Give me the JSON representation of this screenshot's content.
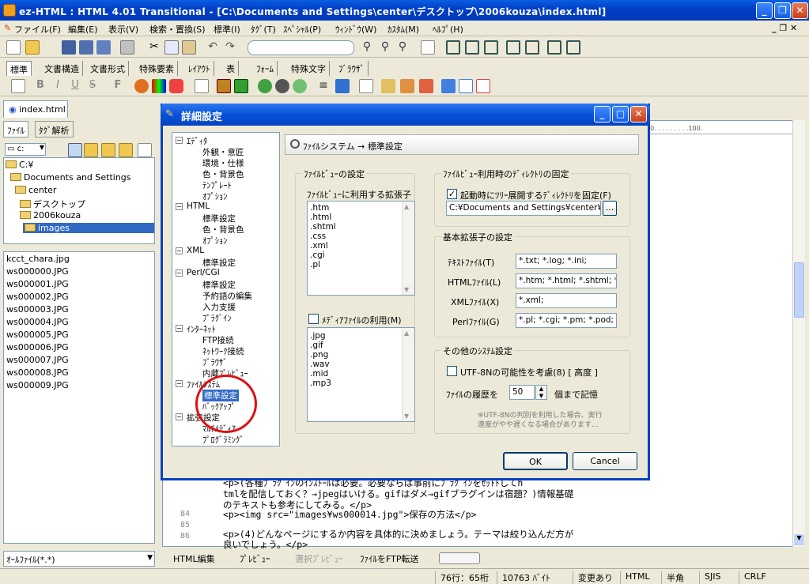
{
  "window": {
    "title": "ez-HTML : HTML 4.01 Transitional - [C:\\Documents and Settings\\center\\デスクトップ\\2006kouza\\index.html]"
  },
  "menu": [
    "ファイル(F)",
    "編集(E)",
    "表示(V)",
    "検索・置換(S)",
    "標準(I)",
    "ﾀｸﾞ(T)",
    "ｽﾍﾟｼｬﾙ(P)",
    "ｳｨﾝﾄﾞｳ(W)",
    "ｶｽﾀﾑ(M)",
    "ﾍﾙﾌﾟ(H)"
  ],
  "tag_tabs": [
    "標準",
    "文書構造",
    "文書形式",
    "特殊要素",
    "ﾚｲｱｳﾄ",
    "表",
    "ﾌｫｰﾑ",
    "特殊文字",
    "ﾌﾞﾗｳｻﾞ"
  ],
  "left": {
    "doc_tab": "index.html",
    "panel_tabs": [
      "ﾌｧｲﾙ",
      "ﾀｸﾞ解析"
    ],
    "drive": "c:",
    "tree": [
      "C:¥",
      "Documents and Settings",
      "center",
      "デスクトップ",
      "2006kouza",
      "images"
    ],
    "files": [
      "kcct_chara.jpg",
      "ws000000.JPG",
      "ws000001.JPG",
      "ws000002.JPG",
      "ws000003.JPG",
      "ws000004.JPG",
      "ws000005.JPG",
      "ws000006.JPG",
      "ws000007.JPG",
      "ws000008.JPG",
      "ws000009.JPG"
    ],
    "filter": "ｵｰﾙﾌｧｲﾙ(*.*)"
  },
  "editor": {
    "ruler": "90.  .  .  .  .  .  .  .  .100.",
    "lines": [
      {
        "num": "",
        "text": "<p>(各種ﾌﾟﾗｸﾞｲﾝのｲﾝｽﾄｰﾙは必要。必要ならば事前にﾌﾟﾗｸﾞｲﾝをｾｯﾄﾄしてh"
      },
      {
        "num": "",
        "text": "tmlを配信しておく？→jpegはいける。gifはダメ→gifブラグインは宿題？)情報基礎"
      },
      {
        "num": "",
        "text": "のテキストも参考にしてみる。</p>"
      },
      {
        "num": "84",
        "text": "<p><img src=\"images¥ws000014.jpg\">保存の方法</p>"
      },
      {
        "num": "85",
        "text": ""
      },
      {
        "num": "86",
        "text": "<p>(4)どんなページにするか内容を具体的に決めましょう。テーマは絞り込んだ方が"
      },
      {
        "num": "",
        "text": "良いでしょう。</p>"
      }
    ]
  },
  "bottom_tabs": [
    "HTML編集",
    "ﾌﾟﾚﾋﾞｭｰ",
    "選択ﾌﾟﾚﾋﾞｭｰ",
    "ﾌｧｲﾙをFTP転送"
  ],
  "status": [
    "76行：65桁",
    "10763 ﾊﾞｲﾄ",
    "変更あり",
    "HTML",
    "半角",
    "SJIS",
    "CRLF"
  ],
  "dialog": {
    "title": "詳細設定",
    "tree": [
      {
        "label": "ｴﾃﾞｨﾀ",
        "level": 0
      },
      {
        "label": "外観・意匠",
        "level": 1
      },
      {
        "label": "環境・仕様",
        "level": 1
      },
      {
        "label": "色・背景色",
        "level": 1
      },
      {
        "label": "ﾃﾝﾌﾟﾚｰﾄ",
        "level": 1
      },
      {
        "label": "ｵﾌﾟｼｮﾝ",
        "level": 1
      },
      {
        "label": "HTML",
        "level": 0
      },
      {
        "label": "標準設定",
        "level": 1
      },
      {
        "label": "色・背景色",
        "level": 1
      },
      {
        "label": "ｵﾌﾟｼｮﾝ",
        "level": 1
      },
      {
        "label": "XML",
        "level": 0
      },
      {
        "label": "標準設定",
        "level": 1
      },
      {
        "label": "Perl/CGI",
        "level": 0
      },
      {
        "label": "標準設定",
        "level": 1
      },
      {
        "label": "予約語の編集",
        "level": 1
      },
      {
        "label": "入力支援",
        "level": 1
      },
      {
        "label": "ﾌﾟﾗｸﾞｲﾝ",
        "level": 1
      },
      {
        "label": "ｲﾝﾀｰﾈｯﾄ",
        "level": 0
      },
      {
        "label": "FTP接続",
        "level": 1
      },
      {
        "label": "ﾈｯﾄﾜｰｸ接続",
        "level": 1
      },
      {
        "label": "ﾌﾞﾗｳｻﾞ",
        "level": 1
      },
      {
        "label": "内蔵ﾌﾟﾚﾋﾞｭｰ",
        "level": 1
      },
      {
        "label": "ﾌｧｲﾙｼｽﾃﾑ",
        "level": 0
      },
      {
        "label": "標準設定",
        "level": 1,
        "selected": true
      },
      {
        "label": "ﾊﾞｯｸｱｯﾌﾟ",
        "level": 1
      },
      {
        "label": "拡張設定",
        "level": 0
      },
      {
        "label": "ﾏﾙﾁﾒﾃﾞｨｱ",
        "level": 1
      },
      {
        "label": "ﾌﾟﾛｸﾞﾗﾐﾝｸﾞ",
        "level": 1
      }
    ],
    "header": "ﾌｧｲﾙシステム → 標準設定",
    "fileview": {
      "group": "ﾌｧｲﾙﾋﾞｭｰの設定",
      "ext_label": "ﾌｧｲﾙﾋﾞｭｰに利用する拡張子",
      "exts": [
        ".htm",
        ".html",
        ".shtml",
        ".css",
        ".xml",
        ".cgi",
        ".pl"
      ],
      "media_label": "ﾒﾃﾞｨｱﾌｧｲﾙの利用(M)",
      "media_checked": false,
      "media_exts": [
        ".jpg",
        ".gif",
        ".png",
        ".wav",
        ".mid",
        ".mp3"
      ]
    },
    "dir": {
      "group": "ﾌｧｲﾙﾋﾞｭｰ利用時のﾃﾞｨﾚｸﾄﾘの固定",
      "chk_label": "起動時にﾂﾘｰ展開するﾃﾞｨﾚｸﾄﾘを固定(F)",
      "checked": true,
      "path": "C:¥Documents and Settings¥center¥",
      "browse": "..."
    },
    "ext": {
      "group": "基本拡張子の設定",
      "rows": [
        {
          "label": "ﾃｷｽﾄﾌｧｲﾙ(T)",
          "value": "*.txt; *.log; *.ini;"
        },
        {
          "label": "HTMLﾌｧｲﾙ(L)",
          "value": "*.htm; *.html; *.shtml; *.v"
        },
        {
          "label": "XMLﾌｧｲﾙ(X)",
          "value": "*.xml;"
        },
        {
          "label": "Perlﾌｧｲﾙ(G)",
          "value": "*.pl; *.cgi; *.pm; *.pod;"
        }
      ]
    },
    "other": {
      "group": "その他のｼｽﾃﾑ設定",
      "utf_label": "UTF-8Nの可能性を考慮(8) [ 高度 ]",
      "utf_checked": false,
      "history_label": "ﾌｧｲﾙの履歴を",
      "history_value": "50",
      "history_suffix": "個まで記憶",
      "note1": "※UTF-8Nの判別を利用した場合、実行",
      "note2": "速度がやや遅くなる場合があります..."
    },
    "ok": "OK",
    "cancel": "Cancel"
  }
}
